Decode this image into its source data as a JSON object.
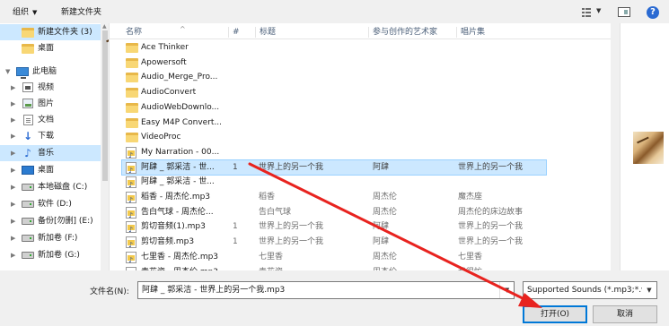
{
  "toolbar": {
    "organize_label": "组织",
    "organize_caret": "▼",
    "new_folder_label": "新建文件夹",
    "view_caret": "▼",
    "help_glyph": "?"
  },
  "nav": {
    "items": [
      {
        "label": "新建文件夹 (3)",
        "icon": "folder-icon"
      },
      {
        "label": "桌面",
        "icon": "folder-icon"
      },
      {
        "label": "此电脑",
        "icon": "computer-icon"
      },
      {
        "label": "视频",
        "icon": "video-icon"
      },
      {
        "label": "图片",
        "icon": "pictures-icon"
      },
      {
        "label": "文档",
        "icon": "documents-icon"
      },
      {
        "label": "下载",
        "icon": "download-icon"
      },
      {
        "label": "音乐",
        "icon": "music-icon"
      },
      {
        "label": "桌面",
        "icon": "desktop-icon"
      },
      {
        "label": "本地磁盘 (C:)",
        "icon": "drive-icon"
      },
      {
        "label": "软件 (D:)",
        "icon": "drive-icon"
      },
      {
        "label": "备份[勿删] (E:)",
        "icon": "drive-icon"
      },
      {
        "label": "新加卷 (F:)",
        "icon": "drive-icon"
      },
      {
        "label": "新加卷 (G:)",
        "icon": "drive-icon"
      }
    ],
    "download_glyph": "↓",
    "music_glyph": "♪"
  },
  "columns": {
    "name": "名称",
    "number": "#",
    "title": "标题",
    "artist": "参与创作的艺术家",
    "album": "唱片集"
  },
  "files": [
    {
      "name": "Ace Thinker",
      "type": "folder",
      "num": "",
      "title": "",
      "artist": "",
      "album": ""
    },
    {
      "name": "Apowersoft",
      "type": "folder",
      "num": "",
      "title": "",
      "artist": "",
      "album": ""
    },
    {
      "name": "Audio_Merge_Pro...",
      "type": "folder",
      "num": "",
      "title": "",
      "artist": "",
      "album": ""
    },
    {
      "name": "AudioConvert",
      "type": "folder",
      "num": "",
      "title": "",
      "artist": "",
      "album": ""
    },
    {
      "name": "AudioWebDownlo...",
      "type": "folder",
      "num": "",
      "title": "",
      "artist": "",
      "album": ""
    },
    {
      "name": "Easy M4P Convert...",
      "type": "folder",
      "num": "",
      "title": "",
      "artist": "",
      "album": ""
    },
    {
      "name": "VideoProc",
      "type": "folder",
      "num": "",
      "title": "",
      "artist": "",
      "album": ""
    },
    {
      "name": "My Narration - 00...",
      "type": "mp3",
      "num": "",
      "title": "",
      "artist": "",
      "album": ""
    },
    {
      "name": "阿肆 _ 郭采洁 - 世...",
      "type": "mp3",
      "num": "1",
      "title": "世界上的另一个我",
      "artist": "阿肆",
      "album": "世界上的另一个我",
      "selected": true
    },
    {
      "name": "阿肆 _ 郭采洁 - 世...",
      "type": "mp3",
      "num": "",
      "title": "",
      "artist": "",
      "album": ""
    },
    {
      "name": "稻香 - 周杰伦.mp3",
      "type": "mp3",
      "num": "",
      "title": "稻香",
      "artist": "周杰伦",
      "album": "魔杰座"
    },
    {
      "name": "告白气球 - 周杰伦...",
      "type": "mp3",
      "num": "",
      "title": "告白气球",
      "artist": "周杰伦",
      "album": "周杰伦的床边故事"
    },
    {
      "name": "剪切音频(1).mp3",
      "type": "mp3",
      "num": "1",
      "title": "世界上的另一个我",
      "artist": "阿肆",
      "album": "世界上的另一个我"
    },
    {
      "name": "剪切音频.mp3",
      "type": "mp3",
      "num": "1",
      "title": "世界上的另一个我",
      "artist": "阿肆",
      "album": "世界上的另一个我"
    },
    {
      "name": "七里香 - 周杰伦.mp3",
      "type": "mp3",
      "num": "",
      "title": "七里香",
      "artist": "周杰伦",
      "album": "七里香"
    },
    {
      "name": "青花瓷 - 周杰伦.mp3",
      "type": "mp3",
      "num": "",
      "title": "青花瓷",
      "artist": "周杰伦",
      "album": "我很忙"
    }
  ],
  "bottom": {
    "filename_label": "文件名(N):",
    "filename_value": "阿肆 _ 郭采洁 - 世界上的另一个我.mp3",
    "filetype_value": "Supported Sounds (*.mp3;*.w",
    "open_label": "打开(O)",
    "cancel_label": "取消",
    "drop_caret": "▼"
  },
  "colors": {
    "selection": "#cce8ff",
    "annotation_arrow": "#e8231f",
    "default_button_border": "#0078d7"
  }
}
